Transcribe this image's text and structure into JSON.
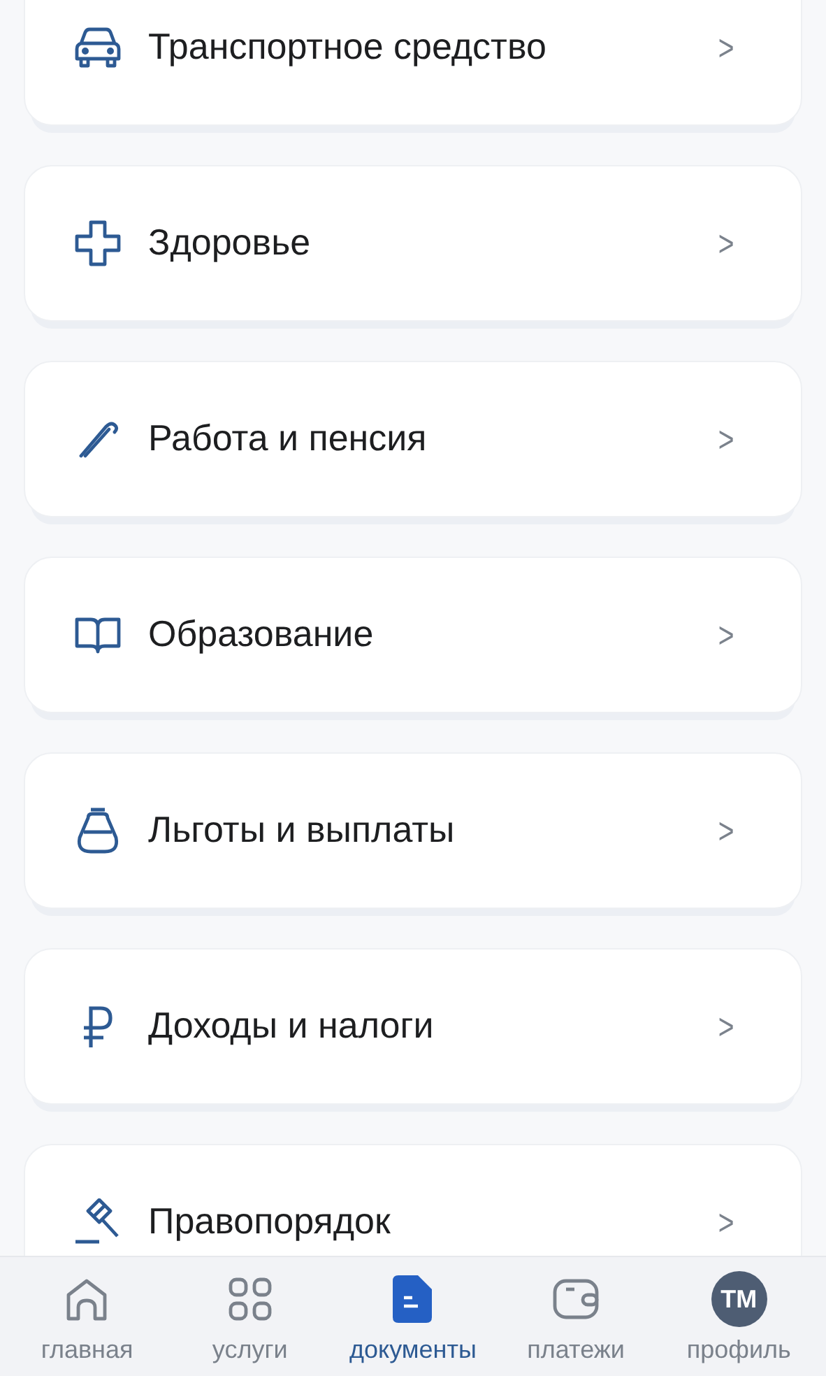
{
  "categories": [
    {
      "kind": "car",
      "label": "Транспортное средство",
      "chevron": ">"
    },
    {
      "kind": "cross",
      "label": "Здоровье",
      "chevron": ">"
    },
    {
      "kind": "cane",
      "label": "Работа и пенсия",
      "chevron": ">"
    },
    {
      "kind": "book",
      "label": "Образование",
      "chevron": ">"
    },
    {
      "kind": "purse",
      "label": "Льготы и выплаты",
      "chevron": ">"
    },
    {
      "kind": "ruble",
      "label": "Доходы и налоги",
      "chevron": ">"
    },
    {
      "kind": "gavel",
      "label": "Правопорядок",
      "chevron": ">"
    }
  ],
  "bottom_nav": [
    {
      "kind": "home",
      "label": "главная",
      "selected": false
    },
    {
      "kind": "grid",
      "label": "услуги",
      "selected": false
    },
    {
      "kind": "document",
      "label": "документы",
      "selected": true
    },
    {
      "kind": "wallet",
      "label": "платежи",
      "selected": false
    },
    {
      "kind": "avatar",
      "label": "профиль",
      "initials": "ТМ",
      "selected": false
    }
  ]
}
